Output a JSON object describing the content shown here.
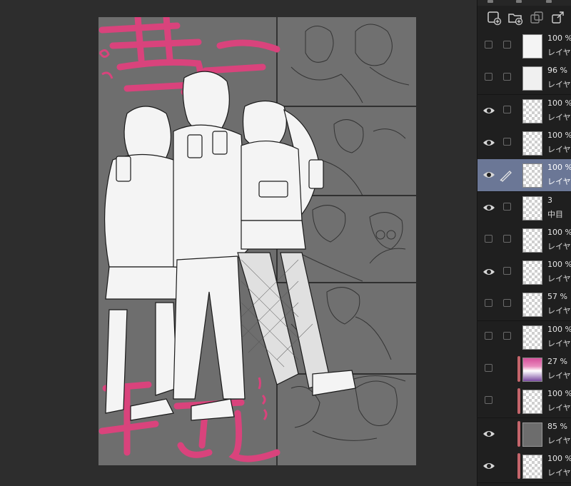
{
  "canvas": {
    "artwork_alt": "Manga-style line art of three characters holding drinks on a gray background with pink brush text",
    "background_color": "#6e6e6e",
    "accent_color": "#d9437c"
  },
  "layer_panel": {
    "toolbar_icons": [
      "new-layer-icon",
      "new-folder-icon",
      "copy-layer-icon",
      "export-layer-icon"
    ],
    "layers": [
      {
        "visible": false,
        "opacity": "100 %",
        "name": "レイヤー",
        "thumb": "white"
      },
      {
        "visible": false,
        "opacity": "96 %",
        "name": "レイヤー",
        "thumb": "photo"
      },
      {
        "visible": true,
        "opacity": "100 %",
        "name": "レイヤー",
        "thumb": "checker"
      },
      {
        "visible": true,
        "opacity": "100 %",
        "name": "レイヤー",
        "thumb": "checker"
      },
      {
        "visible": true,
        "opacity": "100 %",
        "name": "レイヤー",
        "thumb": "checker",
        "selected": true,
        "pen": true
      },
      {
        "visible": true,
        "opacity": "3",
        "name": "中目",
        "thumb": "checker",
        "folder": true
      },
      {
        "visible": false,
        "opacity": "100 %",
        "name": "レイヤー",
        "thumb": "checker"
      },
      {
        "visible": true,
        "opacity": "100 %",
        "name": "レイヤー",
        "thumb": "checker"
      },
      {
        "visible": false,
        "opacity": "57 %",
        "name": "レイヤー",
        "thumb": "checker"
      },
      {
        "visible": false,
        "opacity": "100 %",
        "name": "レイヤー",
        "thumb": "checker"
      },
      {
        "visible": false,
        "opacity": "27 %",
        "name": "レイヤー",
        "thumb": "gradient",
        "red_strip": true
      },
      {
        "visible": false,
        "opacity": "100 %",
        "name": "レイヤー",
        "thumb": "checker",
        "red_strip": true
      },
      {
        "visible": true,
        "opacity": "85 %",
        "name": "レイヤー",
        "thumb": "gray",
        "red_strip": true
      },
      {
        "visible": true,
        "opacity": "100 %",
        "name": "レイヤー",
        "thumb": "checker",
        "red_strip": true
      }
    ]
  }
}
